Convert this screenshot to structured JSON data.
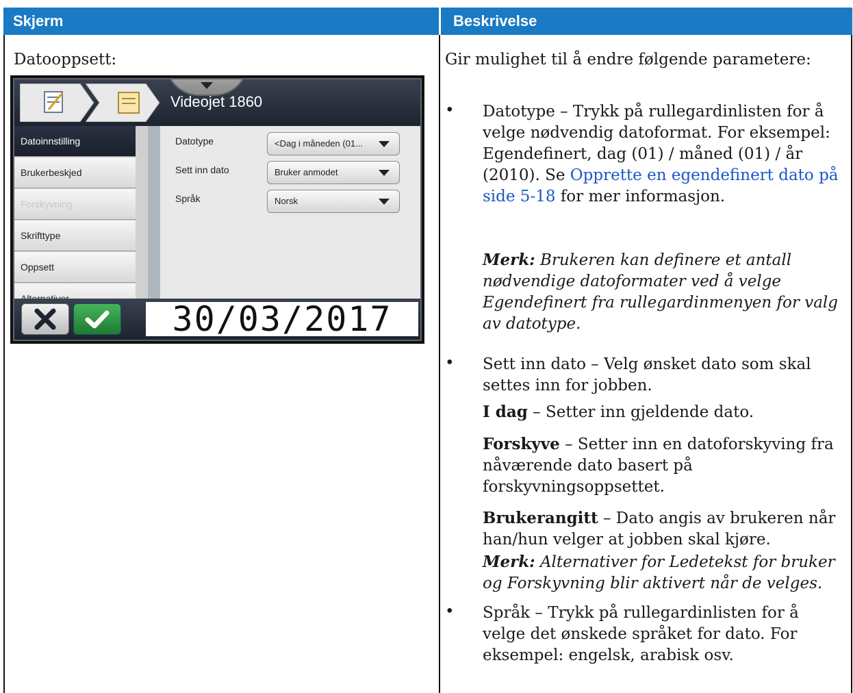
{
  "table": {
    "col1_header": "Skjerm",
    "col2_header": "Beskrivelse"
  },
  "left": {
    "caption": "Datooppsett:"
  },
  "device": {
    "title": "Videojet 1860",
    "sidebar": [
      {
        "label": "Datoinnstilling",
        "state": "active"
      },
      {
        "label": "Brukerbeskjed",
        "state": "normal"
      },
      {
        "label": "Forskyvning",
        "state": "disabled"
      },
      {
        "label": "Skrifttype",
        "state": "normal"
      },
      {
        "label": "Oppsett",
        "state": "normal"
      },
      {
        "label": "Alternativer",
        "state": "normal"
      }
    ],
    "fields": [
      {
        "label": "Datotype",
        "value": "<Dag i måneden (01..."
      },
      {
        "label": "Sett inn dato",
        "value": "Bruker anmodet"
      },
      {
        "label": "Språk",
        "value": "Norsk"
      }
    ],
    "date_display": "30/03/2017",
    "colors": {
      "header": "#1d2330",
      "ok": "#2e9a45"
    },
    "icons": {
      "cancel": "close-icon",
      "confirm": "check-icon",
      "crumb1": "edit-document-icon",
      "crumb2": "document-icon"
    }
  },
  "right": {
    "intro": "Gir mulighet til å endre følgende parametere:",
    "datotype": {
      "text1": "Datotype – Trykk på rullegardinlisten for å velge nødvendig datoformat. For eksempel: Egendefinert, dag (01) / måned (01) / år (2010). Se ",
      "link": "Opprette en egendefinert dato på side 5-18",
      "text2": " for mer informasjon."
    },
    "note1": {
      "label": "Merk:",
      "text": " Brukeren kan definere et antall nødvendige datoformater ved å velge Egendefinert fra rullegardinmenyen for valg av datotype."
    },
    "sett_inn": "Sett inn dato – Velg ønsket dato som skal settes inn for jobben.",
    "idag": {
      "label": "I dag",
      "text": " – Setter inn gjeldende dato."
    },
    "forskyve": {
      "label": "Forskyve",
      "text": " – Setter inn en datoforskyving fra nåværende dato basert på forskyvningsoppsettet."
    },
    "brukerangitt": {
      "label": "Brukerangitt",
      "text": " – Dato angis av brukeren når han/hun velger at jobben skal kjøre."
    },
    "note2": {
      "label": "Merk:",
      "text": " Alternativer for Ledetekst for bruker og Forskyvning blir aktivert når de velges."
    },
    "sprak": "Språk – Trykk på rullegardinlisten for å velge det ønskede språket for dato. For eksempel: engelsk, arabisk osv.",
    "bullet_char": "•"
  }
}
